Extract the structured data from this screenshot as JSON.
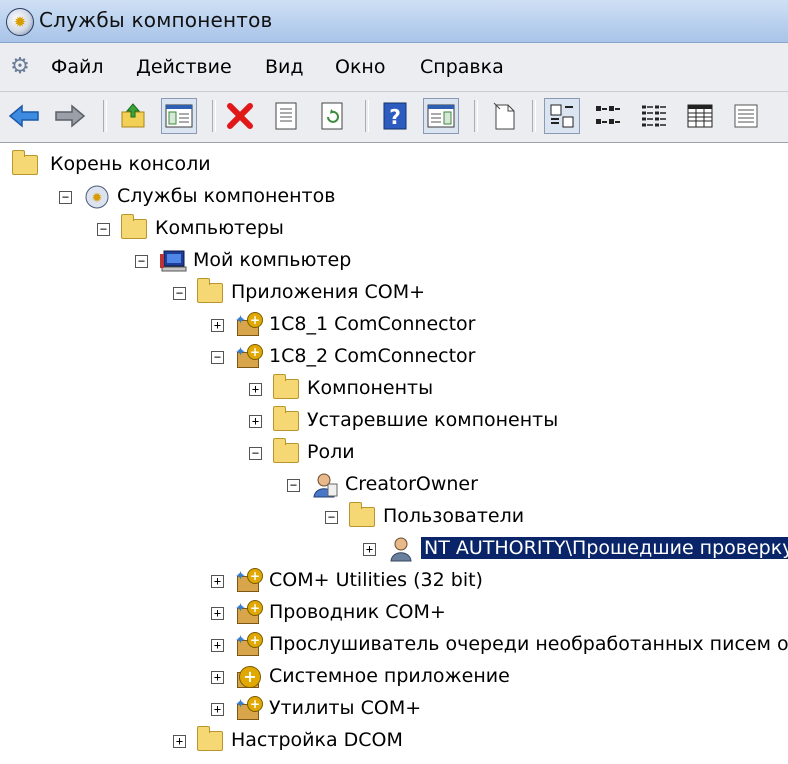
{
  "window": {
    "title": "Службы компонентов"
  },
  "menu": [
    "Файл",
    "Действие",
    "Вид",
    "Окно",
    "Справка"
  ],
  "toolbar": {
    "buttons": [
      "back-icon",
      "forward-icon",
      "up-folder-icon",
      "show-hide-tree-icon",
      "delete-icon",
      "properties-icon",
      "refresh-icon",
      "help-icon",
      "action-pane-icon",
      "export-list-icon",
      "large-icons-view-icon",
      "small-icons-view-icon",
      "list-view-icon",
      "detail-view-icon",
      "extra-view-icon"
    ]
  },
  "tree": [
    {
      "label": "Корень консоли",
      "icon": "folder-icon",
      "expander": ""
    },
    {
      "label": "Службы компонентов",
      "icon": "component-services-icon",
      "expander": "−"
    },
    {
      "label": "Компьютеры",
      "icon": "folder-icon",
      "expander": "−"
    },
    {
      "label": "Мой компьютер",
      "icon": "computer-icon",
      "expander": "−"
    },
    {
      "label": "Приложения COM+",
      "icon": "folder-icon",
      "expander": "−"
    },
    {
      "label": "1C8_1 ComConnector",
      "icon": "com-app-icon",
      "expander": "+"
    },
    {
      "label": "1C8_2 ComConnector",
      "icon": "com-app-icon",
      "expander": "−"
    },
    {
      "label": "Компоненты",
      "icon": "folder-icon",
      "expander": "+"
    },
    {
      "label": "Устаревшие компоненты",
      "icon": "folder-icon",
      "expander": "+"
    },
    {
      "label": "Роли",
      "icon": "folder-icon",
      "expander": "−"
    },
    {
      "label": "CreatorOwner",
      "icon": "role-icon",
      "expander": "−"
    },
    {
      "label": "Пользователи",
      "icon": "folder-icon",
      "expander": "−"
    },
    {
      "label": "NT AUTHORITY\\Прошедшие проверку",
      "icon": "user-icon",
      "expander": "+",
      "selected": true
    },
    {
      "label": "COM+ Utilities (32 bit)",
      "icon": "com-app-icon",
      "expander": "+"
    },
    {
      "label": "Проводник COM+",
      "icon": "com-app-icon",
      "expander": "+"
    },
    {
      "label": "Прослушиватель очереди необработанных писем оче",
      "icon": "com-app-icon",
      "expander": "+"
    },
    {
      "label": "Системное приложение",
      "icon": "system-app-icon",
      "expander": "+"
    },
    {
      "label": "Утилиты COM+",
      "icon": "com-app-icon",
      "expander": "+"
    },
    {
      "label": "Настройка DCOM",
      "icon": "folder-icon",
      "expander": "+"
    }
  ]
}
